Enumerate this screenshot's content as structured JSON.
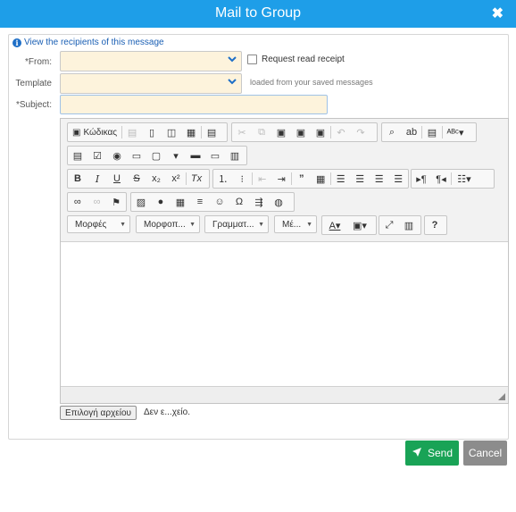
{
  "window": {
    "title": "Mail to Group",
    "close_symbol": "✖"
  },
  "form": {
    "view_recipients_link": "View the recipients of this message",
    "from_label": "*From:",
    "from_value": "",
    "request_read_receipt_label": "Request read receipt",
    "request_read_receipt_checked": false,
    "template_label": "Template",
    "template_value": "",
    "template_note": "loaded from your saved messages",
    "subject_label": "*Subject:",
    "subject_value": ""
  },
  "editor": {
    "toolbar": {
      "source_label": "Κώδικας",
      "combos": [
        {
          "name": "styles",
          "label": "Μορφές"
        },
        {
          "name": "format",
          "label": "Μορφοπ..."
        },
        {
          "name": "font",
          "label": "Γραμματ..."
        },
        {
          "name": "size",
          "label": "Μέ..."
        }
      ]
    },
    "content": ""
  },
  "attachment": {
    "button_label": "Επιλογή αρχείου",
    "status_text": "Δεν ε...χείο."
  },
  "actions": {
    "send_label": "Send",
    "cancel_label": "Cancel"
  },
  "colors": {
    "titlebar": "#1e9ee8",
    "send": "#19a356",
    "cancel": "#8c8c8c",
    "field_bg": "#fdf3dc"
  },
  "icons": [
    "info-icon",
    "close-icon",
    "chevron-down-icon",
    "send-icon"
  ]
}
